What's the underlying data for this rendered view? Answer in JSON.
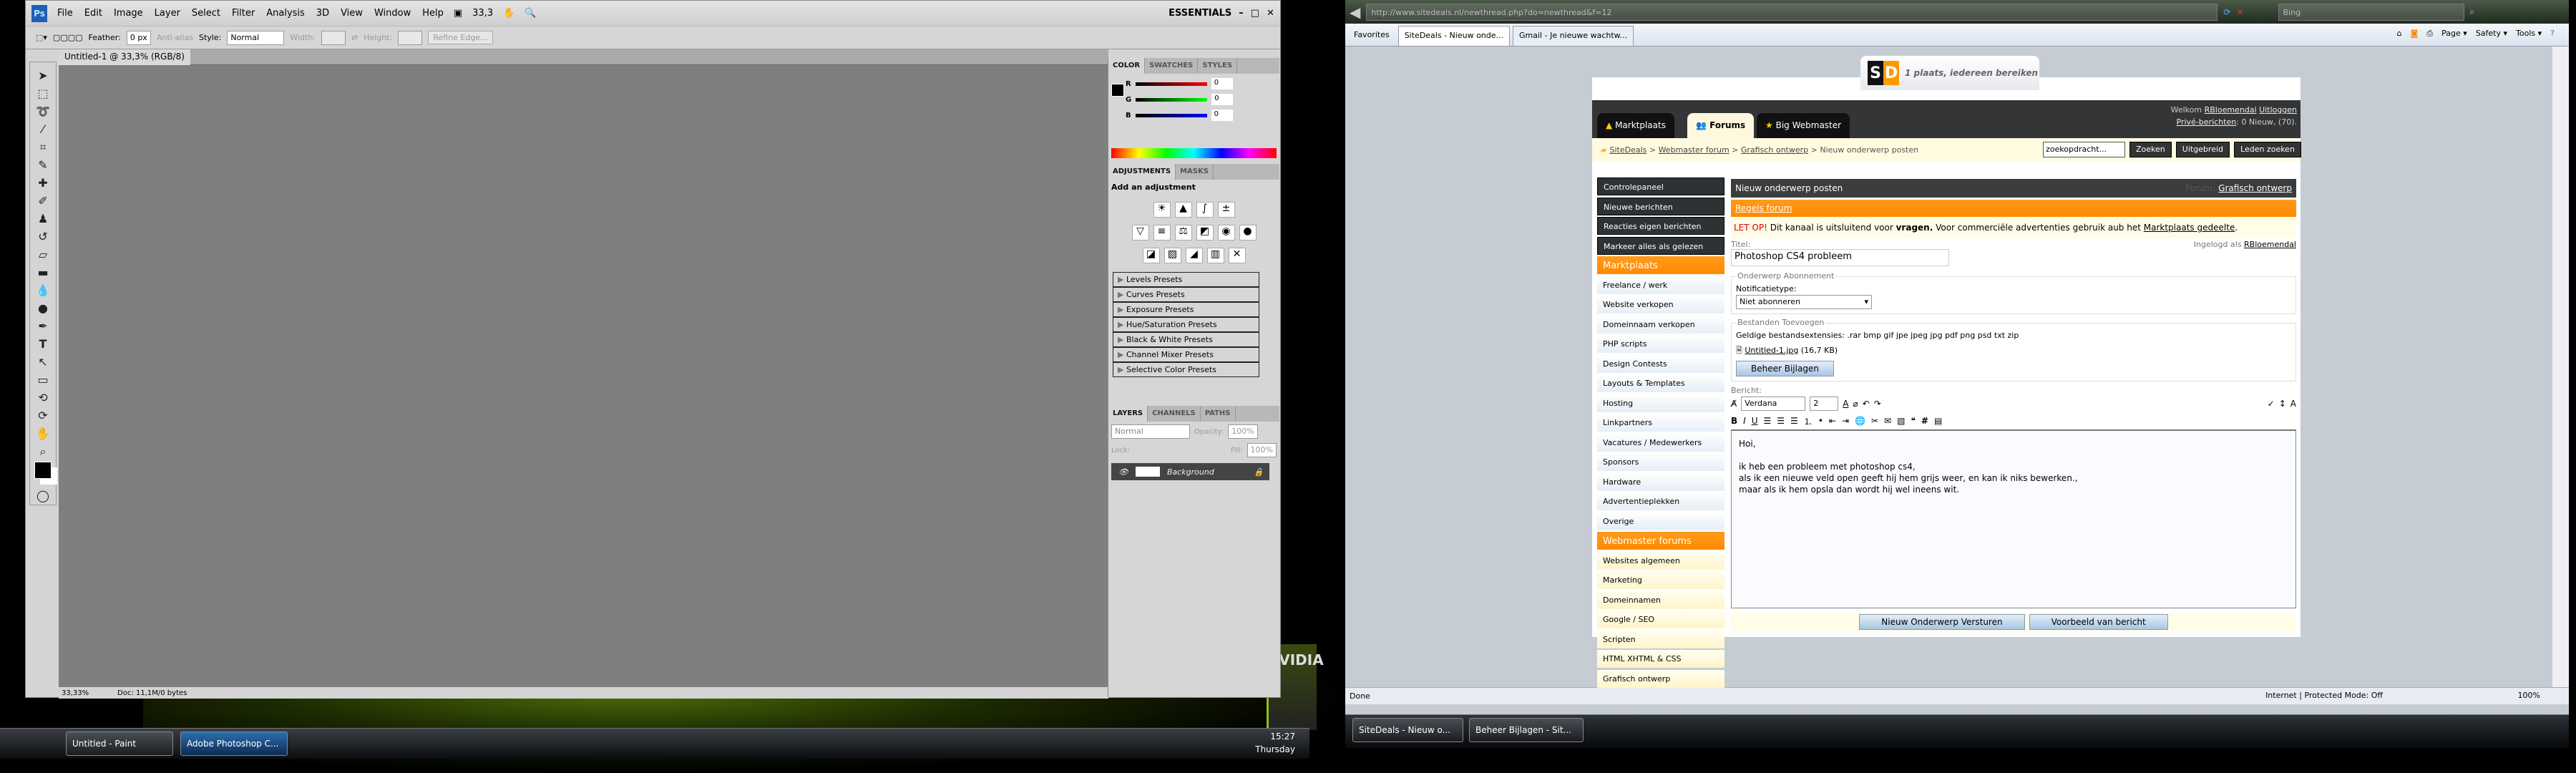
{
  "photoshop": {
    "menu": [
      "File",
      "Edit",
      "Image",
      "Layer",
      "Select",
      "Filter",
      "Analysis",
      "3D",
      "View",
      "Window",
      "Help"
    ],
    "logo": "Ps",
    "zoom": "33,3",
    "workspace": "ESSENTIALS",
    "options": {
      "feather_label": "Feather:",
      "feather_value": "0 px",
      "antialias": "Anti-alias",
      "style_label": "Style:",
      "style_value": "Normal",
      "width_label": "Width:",
      "height_label": "Height:",
      "refine": "Refine Edge..."
    },
    "doc_tab": "Untitled-1 @ 33,3% (RGB/8)",
    "status": {
      "zoom": "33,33%",
      "doc": "Doc: 11,1M/0 bytes"
    },
    "color_panel": {
      "tabs": [
        "COLOR",
        "SWATCHES",
        "STYLES"
      ],
      "r": "0",
      "g": "0",
      "b": "0"
    },
    "adjustments": {
      "tabs": [
        "ADJUSTMENTS",
        "MASKS"
      ],
      "title": "Add an adjustment",
      "presets": [
        "Levels Presets",
        "Curves Presets",
        "Exposure Presets",
        "Hue/Saturation Presets",
        "Black & White Presets",
        "Channel Mixer Presets",
        "Selective Color Presets"
      ]
    },
    "layers": {
      "tabs": [
        "LAYERS",
        "CHANNELS",
        "PATHS"
      ],
      "blend": "Normal",
      "opacity_label": "Opacity:",
      "opacity": "100%",
      "lock_label": "Lock:",
      "fill_label": "Fill:",
      "fill": "100%",
      "layer_name": "Background"
    }
  },
  "taskbar_left": {
    "items": [
      "Untitled - Paint",
      "Adobe Photoshop C..."
    ],
    "time": "15:27",
    "day": "Thursday"
  },
  "desktop": {
    "logo": "NVIDIA"
  },
  "ie": {
    "address": "http://www.sitedeals.nl/newthread.php?do=newthread&f=12",
    "search": "Bing",
    "favorites": "Favorites",
    "tabs": [
      "SiteDeals - Nieuw onde...",
      "Gmail - Je nieuwe wachtw..."
    ],
    "commands": [
      "Page ▾",
      "Safety ▾",
      "Tools ▾"
    ],
    "status": "Done",
    "zone": "Internet | Protected Mode: Off",
    "zoom": "100%"
  },
  "taskbar_ie": {
    "items": [
      "SiteDeals - Nieuw o...",
      "Beheer Bijlagen - Sit..."
    ]
  },
  "site": {
    "logo": "SD",
    "tagline": "1 plaats, iedereen bereiken",
    "nav": [
      "Marktplaats",
      "Forums",
      "Big Webmaster"
    ],
    "welcome": {
      "prefix": "Welkom",
      "user": "RBloemendal",
      "logout": "Uitloggen",
      "pm_link": "Privé-berichten",
      "pm_text": ": 0 Nieuw, (70)."
    },
    "breadcrumb": [
      "SiteDeals",
      "Webmaster forum",
      "Grafisch ontwerp",
      "Nieuw onderwerp posten"
    ],
    "search": {
      "placeholder": "zoekopdracht...",
      "go": "Zoeken",
      "advanced": "Uitgebreid",
      "members": "Leden zoeken"
    },
    "sidebar": [
      {
        "t": "Controlepaneel",
        "k": "dark"
      },
      {
        "t": "Nieuwe berichten",
        "k": "dark"
      },
      {
        "t": "Reacties eigen berichten",
        "k": "dark"
      },
      {
        "t": "Markeer alles als gelezen",
        "k": "dark"
      },
      {
        "t": "Marktplaats",
        "k": "head"
      },
      {
        "t": "Freelance / werk",
        "k": "blue"
      },
      {
        "t": "Website verkopen",
        "k": "blue"
      },
      {
        "t": "Domeinnaam verkopen",
        "k": "blue"
      },
      {
        "t": "PHP scripts",
        "k": "blue"
      },
      {
        "t": "Design Contests",
        "k": "blue"
      },
      {
        "t": "Layouts & Templates",
        "k": "blue"
      },
      {
        "t": "Hosting",
        "k": "blue"
      },
      {
        "t": "Linkpartners",
        "k": "blue"
      },
      {
        "t": "Vacatures / Medewerkers",
        "k": "blue"
      },
      {
        "t": "Sponsors",
        "k": "blue"
      },
      {
        "t": "Hardware",
        "k": "blue"
      },
      {
        "t": "Advertentieplekken",
        "k": "blue"
      },
      {
        "t": "Overige",
        "k": "blue"
      },
      {
        "t": "Webmaster forums",
        "k": "head"
      },
      {
        "t": "Websites algemeen",
        "k": "yellow"
      },
      {
        "t": "Marketing",
        "k": "yellow"
      },
      {
        "t": "Domeinnamen",
        "k": "yellow"
      },
      {
        "t": "Google / SEO",
        "k": "yellow"
      },
      {
        "t": "Scripten",
        "k": "yellow"
      },
      {
        "t": "HTML XHTML & CSS",
        "k": "yellow"
      },
      {
        "t": "Grafisch ontwerp",
        "k": "yellow"
      }
    ],
    "main": {
      "title": "Nieuw onderwerp posten",
      "forum_label": "Forum:",
      "forum": "Grafisch ontwerp",
      "rules": "Regels forum",
      "notice": {
        "warn": "LET OP!",
        "t1": " Dit kanaal is uitsluitend voor ",
        "bold": "vragen.",
        "t2": " Voor commerciële advertenties gebruik aub het ",
        "link": "Marktplaats gedeelte",
        "t3": "."
      },
      "title_label": "Titel:",
      "logged_in": "Ingelogd als",
      "user": "RBloemendal",
      "title_value": "Photoshop CS4 probleem",
      "subscription": {
        "legend": "Onderwerp Abonnement",
        "label": "Notificatietype:",
        "value": "Niet abonneren"
      },
      "attachments": {
        "legend": "Bestanden Toevoegen",
        "extensions": "Geldige bestandsextensies: .rar bmp gif jpe jpeg jpg pdf png psd txt zip",
        "file": "Untitled-1.jpg",
        "size": "(16,7 KB)",
        "manage": "Beheer Bijlagen"
      },
      "message_label": "Bericht:",
      "font": "Verdana",
      "size": "2",
      "message": "Hoi,\n\nik heb een probleem met photoshop cs4,\nals ik een nieuwe veld open geeft hij hem grijs weer, en kan ik niks bewerken.,\nmaar als ik hem opsla dan wordt hij wel ineens wit.",
      "submit": "Nieuw Onderwerp Versturen",
      "preview": "Voorbeeld van bericht"
    }
  }
}
